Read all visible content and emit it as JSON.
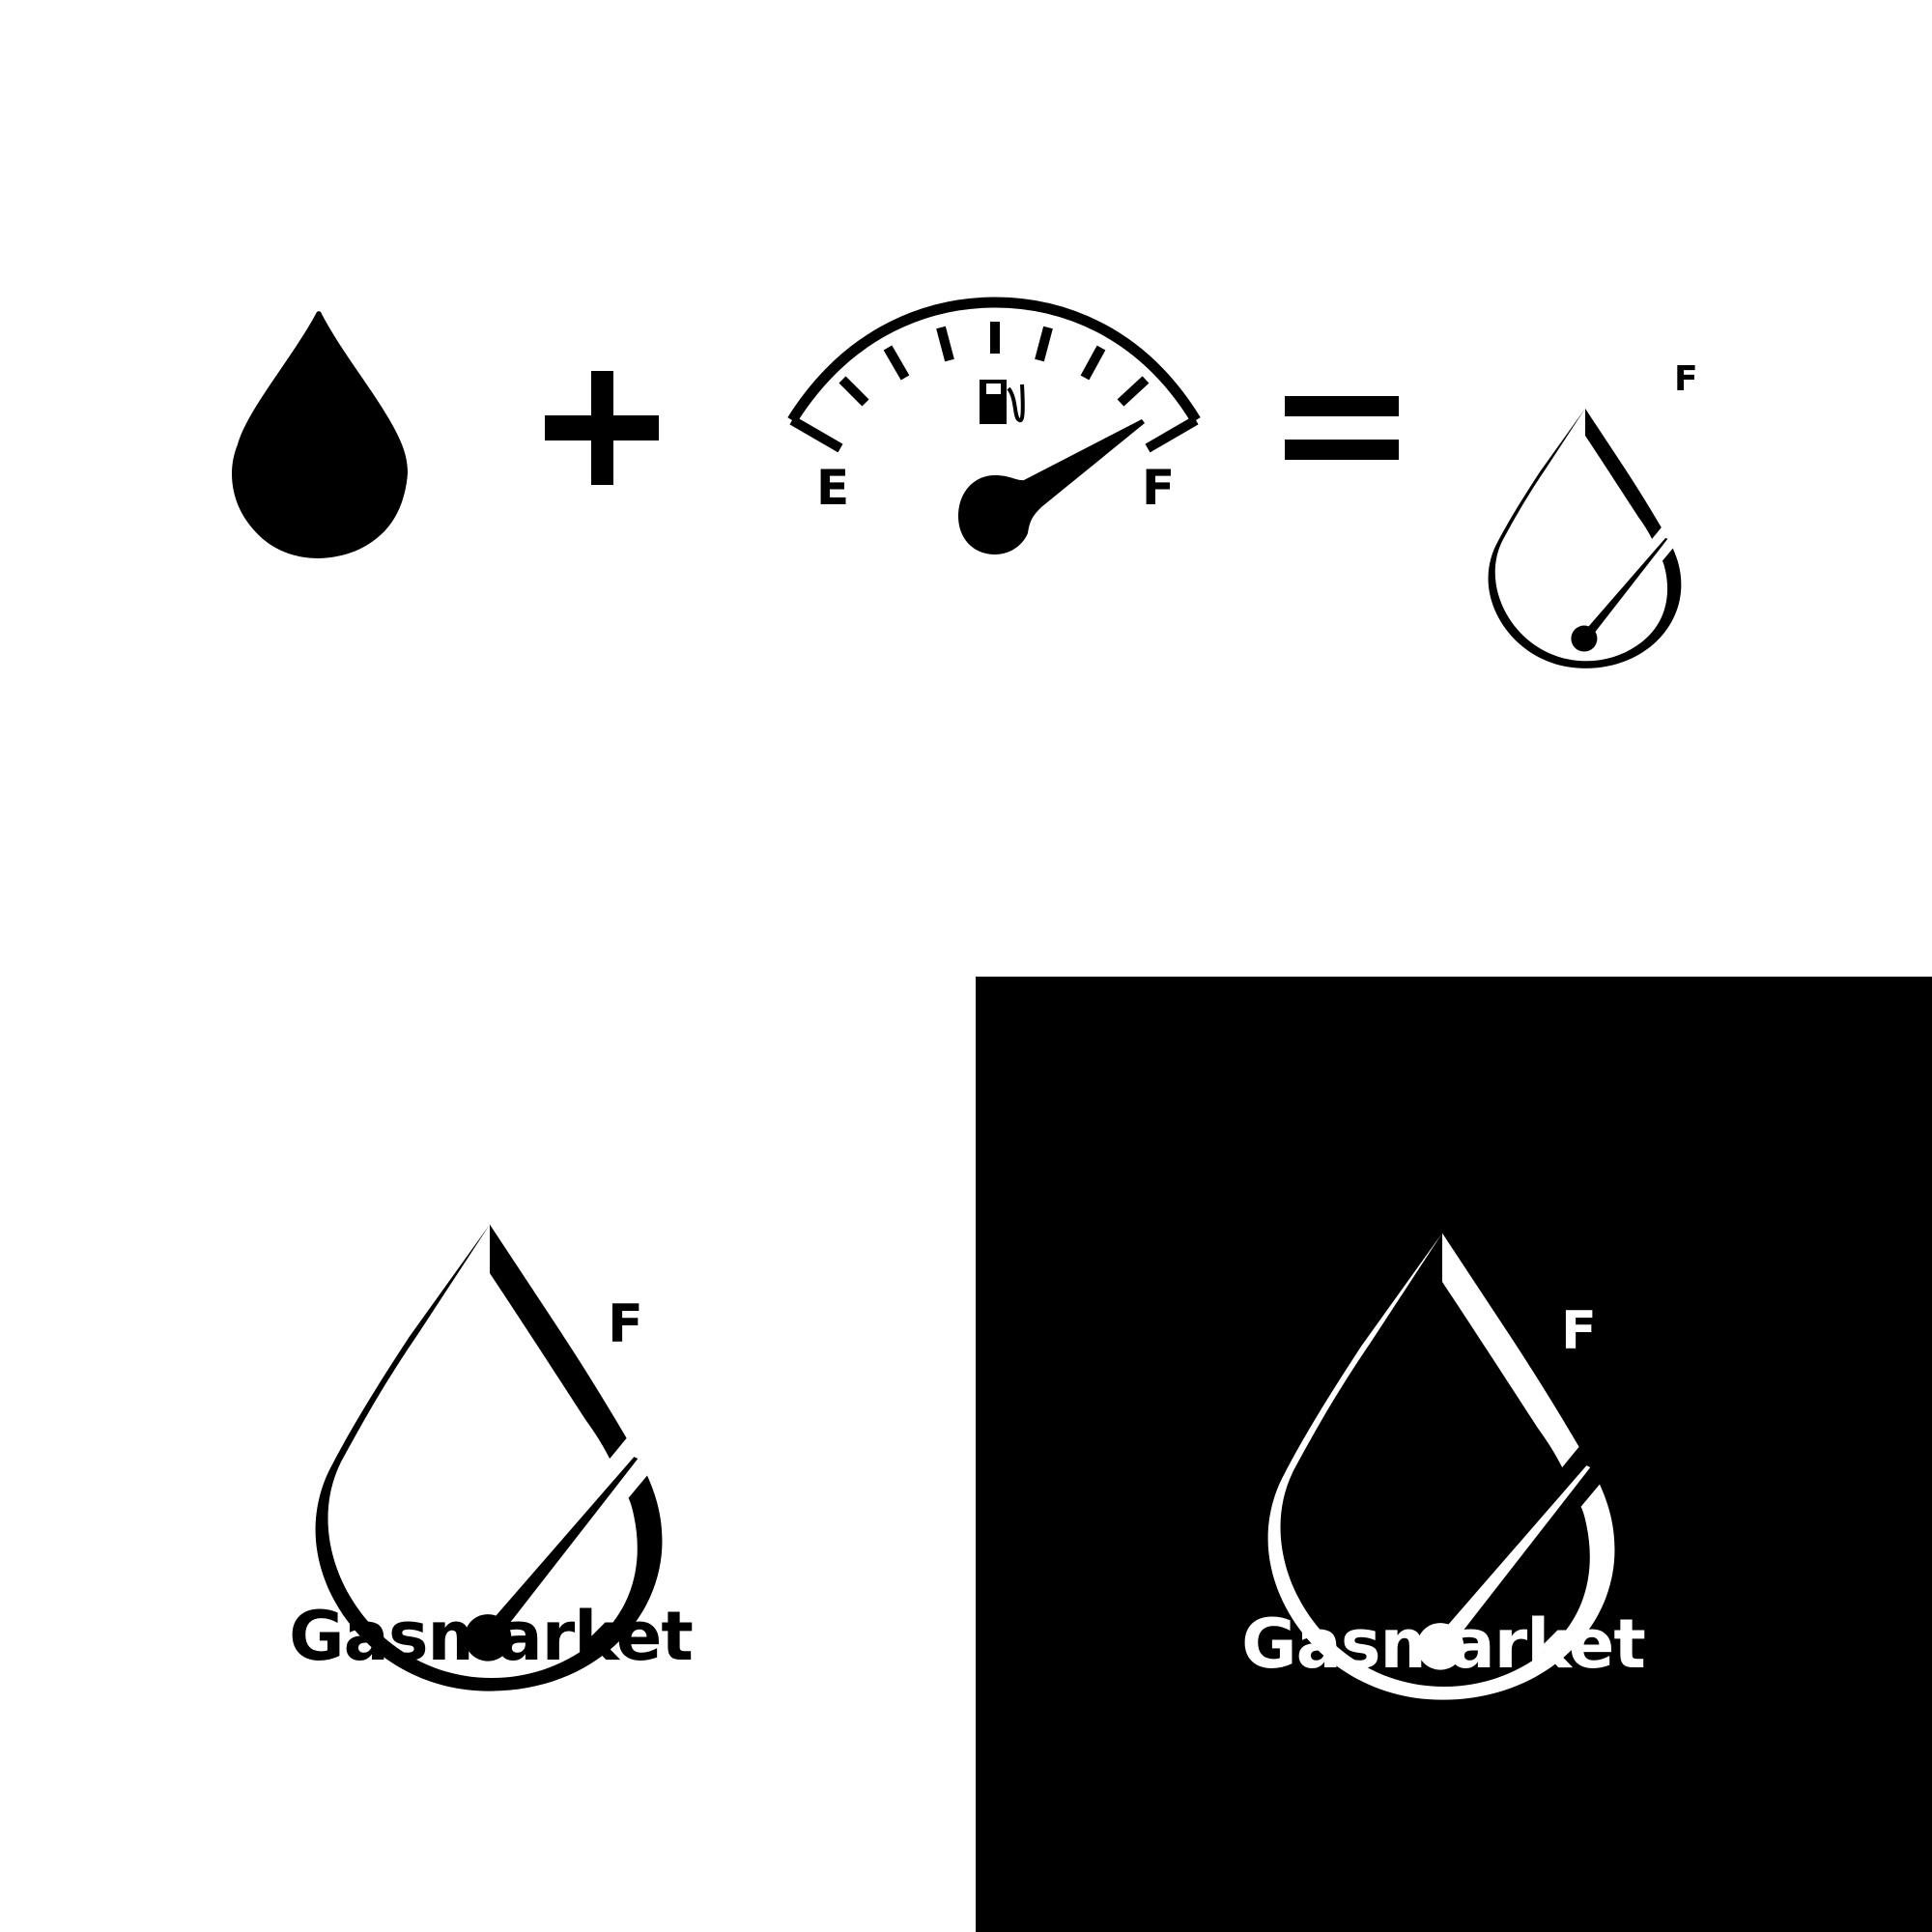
{
  "colors": {
    "background": "#ffffff",
    "ink": "#000000",
    "panel": "#000000",
    "reverse_ink": "#ffffff"
  },
  "concept_row": {
    "items": [
      "drop-icon",
      "plus-icon",
      "fuel-gauge-icon",
      "equals-icon",
      "gasmarket-logo-mark"
    ],
    "gauge": {
      "empty_label": "E",
      "full_label": "F"
    },
    "result_mark": {
      "gauge_label": "F"
    }
  },
  "logo_light": {
    "gauge_label": "F",
    "wordmark": "Gasmarket"
  },
  "logo_dark": {
    "gauge_label": "F",
    "wordmark": "Gasmarket"
  }
}
